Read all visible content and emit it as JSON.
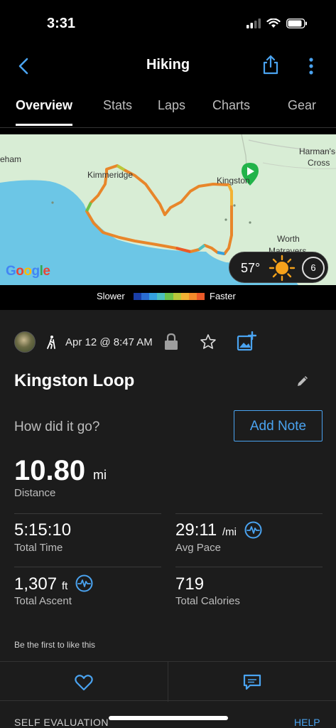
{
  "status_bar": {
    "time": "3:31"
  },
  "nav": {
    "title": "Hiking"
  },
  "tabs": [
    {
      "label": "Overview"
    },
    {
      "label": "Stats"
    },
    {
      "label": "Laps"
    },
    {
      "label": "Charts"
    },
    {
      "label": "Gear"
    }
  ],
  "map": {
    "labels": [
      "eham",
      "Kimmeridge",
      "Kingston",
      "Harman's",
      "Cross",
      "Worth",
      "Matravers"
    ],
    "google": "Google",
    "temperature": "57°",
    "wind": "6"
  },
  "legend": {
    "slower": "Slower",
    "faster": "Faster",
    "colors": [
      "#1a3fa8",
      "#2a6dd2",
      "#34a1e0",
      "#4cc0c0",
      "#6cc24a",
      "#b9c83a",
      "#f2b233",
      "#f28a2a",
      "#ea5a28"
    ]
  },
  "activity": {
    "date": "Apr 12 @ 8:47 AM",
    "title": "Kingston Loop",
    "prompt": "How did it go?",
    "add_note": "Add Note"
  },
  "stats": {
    "distance": {
      "value": "10.80",
      "unit": "mi",
      "label": "Distance"
    },
    "total_time": {
      "value": "5:15:10",
      "label": "Total Time"
    },
    "avg_pace": {
      "value": "29:11",
      "unit": "/mi",
      "label": "Avg Pace"
    },
    "total_ascent": {
      "value": "1,307",
      "unit": "ft",
      "label": "Total Ascent"
    },
    "total_calories": {
      "value": "719",
      "label": "Total Calories"
    }
  },
  "social": {
    "likes": "Be the first to like this"
  },
  "footer": {
    "self_evaluation": "SELF EVALUATION",
    "help": "HELP"
  },
  "colors": {
    "accent": "#4aa3f0",
    "route_orange": "#e8862a",
    "start_green": "#22b34a"
  }
}
